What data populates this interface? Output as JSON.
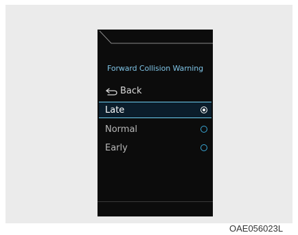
{
  "screen": {
    "title": "Forward Collision Warning",
    "back_label": "Back",
    "options": [
      {
        "label": "Late",
        "selected": true
      },
      {
        "label": "Normal",
        "selected": false
      },
      {
        "label": "Early",
        "selected": false
      }
    ]
  },
  "caption": "OAE056023L",
  "icons": {
    "back": "back-arrow-icon",
    "radio_selected": "radio-selected-icon",
    "radio_unselected": "radio-unselected-icon"
  },
  "colors": {
    "title": "#7fc4e6",
    "highlight": "#6fd0f2",
    "radio": "#3aa9d8",
    "screen_bg": "#0c0c0c"
  }
}
